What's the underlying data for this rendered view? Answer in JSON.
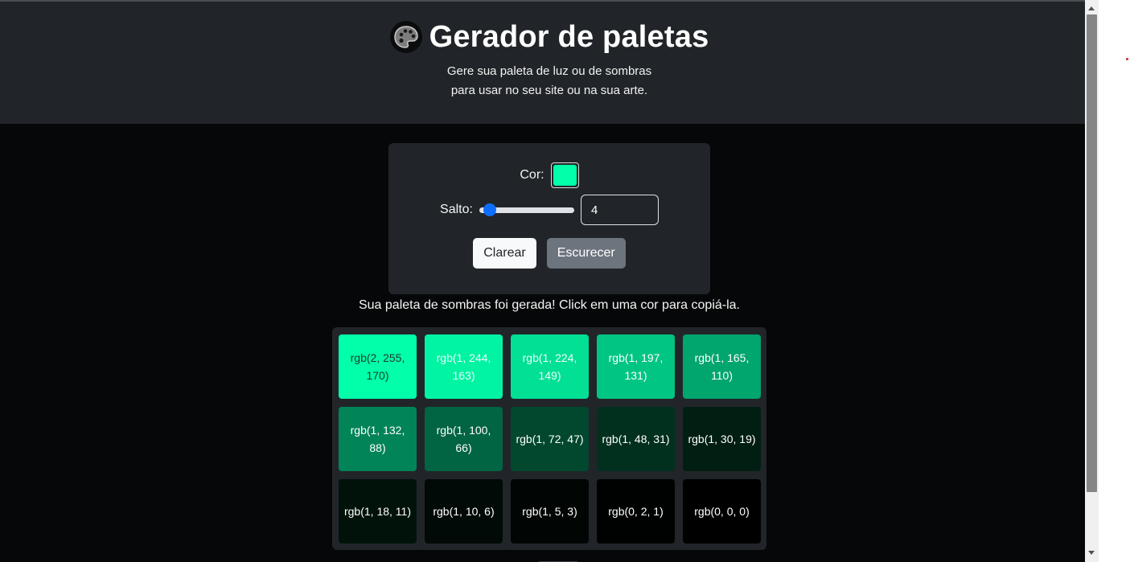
{
  "header": {
    "title": "Gerador de paletas",
    "subtitle_line1": "Gere sua paleta de luz ou de sombras",
    "subtitle_line2": "para usar no seu site ou na sua arte.",
    "logo_icon": "artist-palette-icon"
  },
  "controls": {
    "color_label": "Cor:",
    "color_value": "#02ffaa",
    "step_label": "Salto:",
    "step_value": "4",
    "step_slider_fraction": 0.03,
    "lighten_label": "Clarear",
    "darken_label": "Escurecer"
  },
  "result": {
    "message": "Sua paleta de sombras foi gerada! Click em uma cor para copiá-la."
  },
  "palette": [
    {
      "label": "rgb(2, 255, 170)",
      "color": "#02ffaa",
      "text_color": "#1b3a2e"
    },
    {
      "label": "rgb(1, 244, 163)",
      "color": "#01f4a3",
      "text_color": "#eafff5"
    },
    {
      "label": "rgb(1, 224, 149)",
      "color": "#01e095",
      "text_color": "#eafff5"
    },
    {
      "label": "rgb(1, 197, 131)",
      "color": "#01c583",
      "text_color": "#ffffff"
    },
    {
      "label": "rgb(1, 165, 110)",
      "color": "#01a56e",
      "text_color": "#ffffff"
    },
    {
      "label": "rgb(1, 132, 88)",
      "color": "#018458",
      "text_color": "#ffffff"
    },
    {
      "label": "rgb(1, 100, 66)",
      "color": "#016442",
      "text_color": "#ffffff"
    },
    {
      "label": "rgb(1, 72, 47)",
      "color": "#01482f",
      "text_color": "#ffffff"
    },
    {
      "label": "rgb(1, 48, 31)",
      "color": "#01301f",
      "text_color": "#ffffff"
    },
    {
      "label": "rgb(1, 30, 19)",
      "color": "#011e13",
      "text_color": "#ffffff"
    },
    {
      "label": "rgb(1, 18, 11)",
      "color": "#01120b",
      "text_color": "#ffffff"
    },
    {
      "label": "rgb(1, 10, 6)",
      "color": "#010a06",
      "text_color": "#ffffff"
    },
    {
      "label": "rgb(1, 5, 3)",
      "color": "#010503",
      "text_color": "#ffffff"
    },
    {
      "label": "rgb(0, 2, 1)",
      "color": "#000201",
      "text_color": "#ffffff"
    },
    {
      "label": "rgb(0, 0, 0)",
      "color": "#000000",
      "text_color": "#ffffff"
    }
  ],
  "colors": {
    "page_background": "#060708",
    "panel_background": "#212529",
    "slider_accent": "#0d6efd",
    "darken_button": "#6c757d",
    "lighten_button": "#f8f9fa"
  }
}
